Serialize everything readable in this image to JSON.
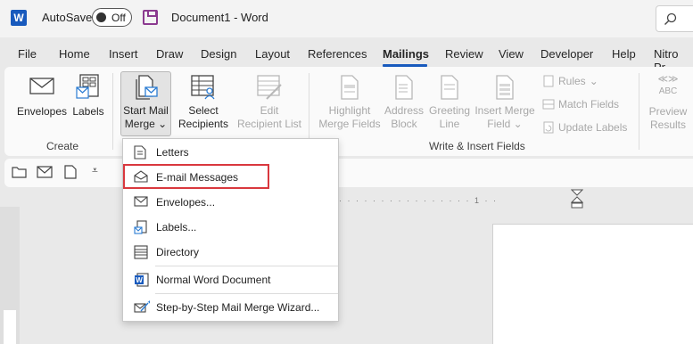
{
  "titlebar": {
    "autosave_label": "AutoSave",
    "autosave_state": "Off",
    "document_title": "Document1 - Word"
  },
  "tabs": [
    {
      "label": "File"
    },
    {
      "label": "Home"
    },
    {
      "label": "Insert"
    },
    {
      "label": "Draw"
    },
    {
      "label": "Design"
    },
    {
      "label": "Layout"
    },
    {
      "label": "References"
    },
    {
      "label": "Mailings",
      "active": true
    },
    {
      "label": "Review"
    },
    {
      "label": "View"
    },
    {
      "label": "Developer"
    },
    {
      "label": "Help"
    },
    {
      "label": "Nitro Pr"
    }
  ],
  "ribbon": {
    "create": {
      "group_label": "Create",
      "envelopes": "Envelopes",
      "labels": "Labels"
    },
    "start": {
      "start_mail_line1": "Start Mail",
      "start_mail_line2": "Merge",
      "select_line1": "Select",
      "select_line2": "Recipients",
      "edit_line1": "Edit",
      "edit_line2": "Recipient List"
    },
    "write": {
      "group_label": "Write & Insert Fields",
      "highlight_line1": "Highlight",
      "highlight_line2": "Merge Fields",
      "address_line1": "Address",
      "address_line2": "Block",
      "greeting_line1": "Greeting",
      "greeting_line2": "Line",
      "insert_line1": "Insert Merge",
      "insert_line2": "Field",
      "rules": "Rules",
      "match_fields": "Match Fields",
      "update_labels": "Update Labels"
    },
    "preview": {
      "abc": "ABC",
      "line1": "Preview",
      "line2": "Results"
    }
  },
  "ruler": {
    "ticks": "· · · · · · · · · · · · · · · · 1 · ·"
  },
  "menu": {
    "items": [
      {
        "label": "Letters",
        "icon": "letter-icon"
      },
      {
        "label": "E-mail Messages",
        "icon": "email-icon"
      },
      {
        "label": "Envelopes...",
        "icon": "envelope-icon"
      },
      {
        "label": "Labels...",
        "icon": "labels-icon"
      },
      {
        "label": "Directory",
        "icon": "directory-icon"
      },
      {
        "label": "Normal Word Document",
        "icon": "word-doc-icon"
      },
      {
        "label": "Step-by-Step Mail Merge Wizard...",
        "icon": "wizard-icon"
      }
    ]
  },
  "colors": {
    "accent": "#185abd",
    "highlight_border": "#d9383e",
    "disabled_text": "#a8a8a8"
  }
}
